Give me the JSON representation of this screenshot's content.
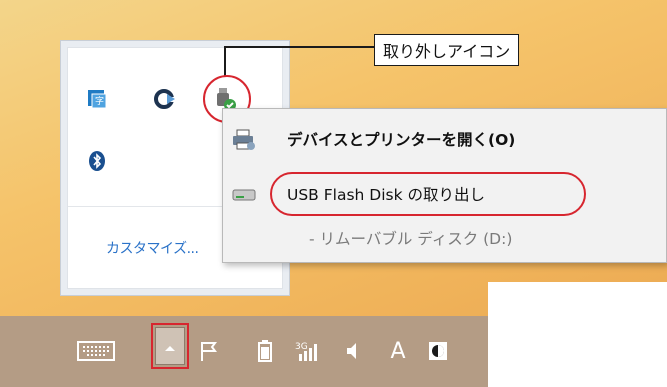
{
  "callout": {
    "label": "取り外しアイコン"
  },
  "overflow": {
    "icons": [
      {
        "name": "input-method-icon",
        "color": "#1f7bc4"
      },
      {
        "name": "sync-app-icon",
        "color": "#1d3350"
      },
      {
        "name": "usb-safe-remove-icon",
        "color": "#3aa046"
      },
      {
        "name": "bluetooth-icon",
        "color": "#1a4f8f"
      }
    ],
    "customize_label": "カスタマイズ..."
  },
  "context_menu": {
    "items": [
      {
        "icon": "printer-icon",
        "label": "デバイスとプリンターを開く(O)"
      },
      {
        "icon": "usb-drive-icon",
        "label": "USB Flash Disk の取り出し"
      },
      {
        "icon": "",
        "label": "- リムーバブル ディスク (D:)"
      }
    ]
  },
  "taskbar": {
    "icons": [
      "keyboard-icon",
      "show-hidden-icons-chevron-up-icon",
      "action-center-flag-icon",
      "battery-icon",
      "signal-icon",
      "volume-icon",
      "ime-mode-icon",
      "ime-language-icon"
    ],
    "ime_text": "A"
  },
  "colors": {
    "highlight": "#d7262f",
    "link": "#2a72c8",
    "taskbar": "#b49c85"
  }
}
